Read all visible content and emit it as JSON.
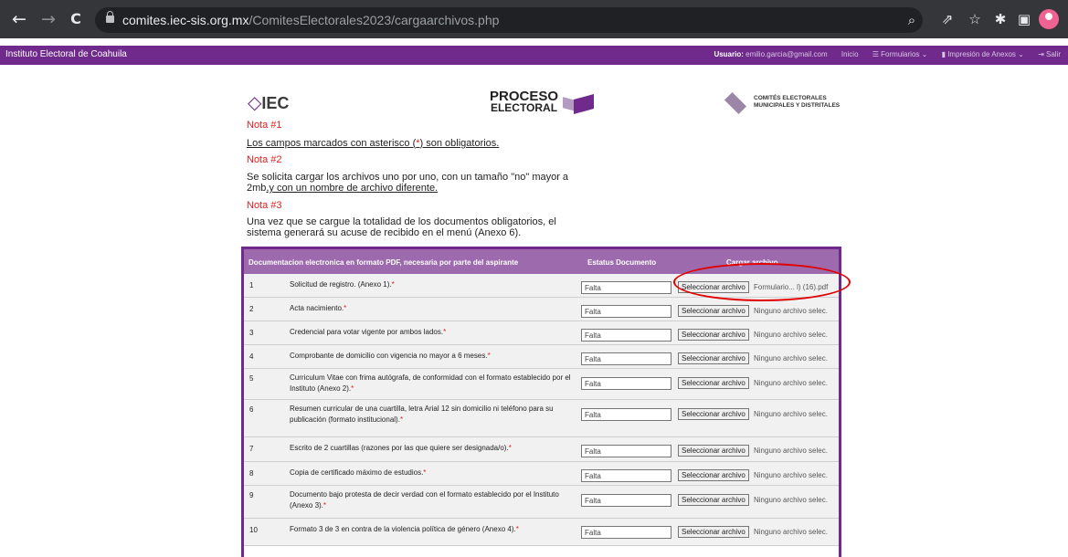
{
  "browser": {
    "back": "←",
    "forward": "→",
    "reload": "C",
    "url_domain": "comites.iec-sis.org.mx",
    "url_path": "/ComitesElectorales2023/cargaarchivos.php",
    "icons": {
      "zoom": "zoom-icon",
      "share": "share-icon",
      "bookmark": "star-icon",
      "extensions": "puzzle-icon",
      "sidepanel": "sidepanel-icon",
      "profile": "profile-icon"
    }
  },
  "navbar": {
    "brand": "Instituto Electoral de Coahuila",
    "user_label": "Usuario:",
    "user_email": "emilio.garcia@gmail.com",
    "inicio": "Inicio",
    "formularios": "☰ Formularios ⌄",
    "impresion": "▮ Impresión de Anexos ⌄",
    "salir": "⇥ Salir"
  },
  "logos": {
    "iec_mark": "◇",
    "iec_text": "IEC",
    "proceso_1": "PROCESO",
    "proceso_2": "ELECTORAL",
    "comites_1": "COMITÉS ELECTORALES",
    "comites_2": "MUNICIPALES Y DISTRITALES"
  },
  "notes": {
    "n1_title": "Nota #1",
    "n1_text_a": "Los campos marcados con asterisco (",
    "n1_ast": "*",
    "n1_text_b": ") son obligatorios.",
    "n2_title": "Nota #2",
    "n2_text_a": "Se solicita cargar los archivos uno por uno, con un tamaño \"no\" mayor a 2mb",
    "n2_text_b": ",y con un nombre de archivo diferente.",
    "n3_title": "Nota #3",
    "n3_text": "Una vez que se cargue la totalidad de los documentos obligatorios, el sistema generará su acuse de recibido en el menú (Anexo 6)."
  },
  "table": {
    "col_doc": "Documentacion electronica en formato PDF, necesaria por parte del aspirante",
    "col_status": "Estatus Documento",
    "col_upload": "Cargar archivo",
    "button_label": "Seleccionar archivo",
    "rows": [
      {
        "num": "1",
        "desc": "Solicitud de registro. (Anexo 1).",
        "ast": "*",
        "status": "Falta",
        "file": "Formulario... l) (16).pdf"
      },
      {
        "num": "2",
        "desc": "Acta nacimiento.",
        "ast": "*",
        "status": "Falta",
        "file": "Ninguno archivo selec."
      },
      {
        "num": "3",
        "desc": "Credencial para votar vigente por ambos lados.",
        "ast": "*",
        "status": "Falta",
        "file": "Ninguno archivo selec."
      },
      {
        "num": "4",
        "desc": "Comprobante de domicilio con vigencia no mayor a 6 meses.",
        "ast": "*",
        "status": "Falta",
        "file": "Ninguno archivo selec."
      },
      {
        "num": "5",
        "desc": "Curriculum Vitae con frima autógrafa, de conformidad con el formato establecido por el Instituto (Anexo 2).",
        "ast": "*",
        "status": "Falta",
        "file": "Ninguno archivo selec."
      },
      {
        "num": "6",
        "desc": "Resumen curricular de una cuartilla, letra Arial 12 sin domicilio ni teléfono para su publicación (formato institucional).",
        "ast": "*",
        "status": "Falta",
        "file": "Ninguno archivo selec."
      },
      {
        "num": "7",
        "desc": "Escrito de 2 cuartillas (razones por las que quiere ser designada/o).",
        "ast": "*",
        "status": "Falta",
        "file": "Ninguno archivo selec."
      },
      {
        "num": "8",
        "desc": "Copia de certificado máximo de estudios.",
        "ast": "*",
        "status": "Falta",
        "file": "Ninguno archivo selec."
      },
      {
        "num": "9",
        "desc": "Documento bajo protesta de decir verdad con el formato establecido por el Instituto (Anexo 3).",
        "ast": "*",
        "status": "Falta",
        "file": "Ninguno archivo selec."
      },
      {
        "num": "10",
        "desc": "Formato 3 de 3 en contra de la violencia política de género (Anexo 4).",
        "ast": "*",
        "status": "Falta",
        "file": "Ninguno archivo selec."
      }
    ]
  },
  "colors": {
    "purple": "#6f2a8c",
    "header": "#9d6aae",
    "note_red": "#e02020",
    "annotation_red": "#e00000"
  }
}
